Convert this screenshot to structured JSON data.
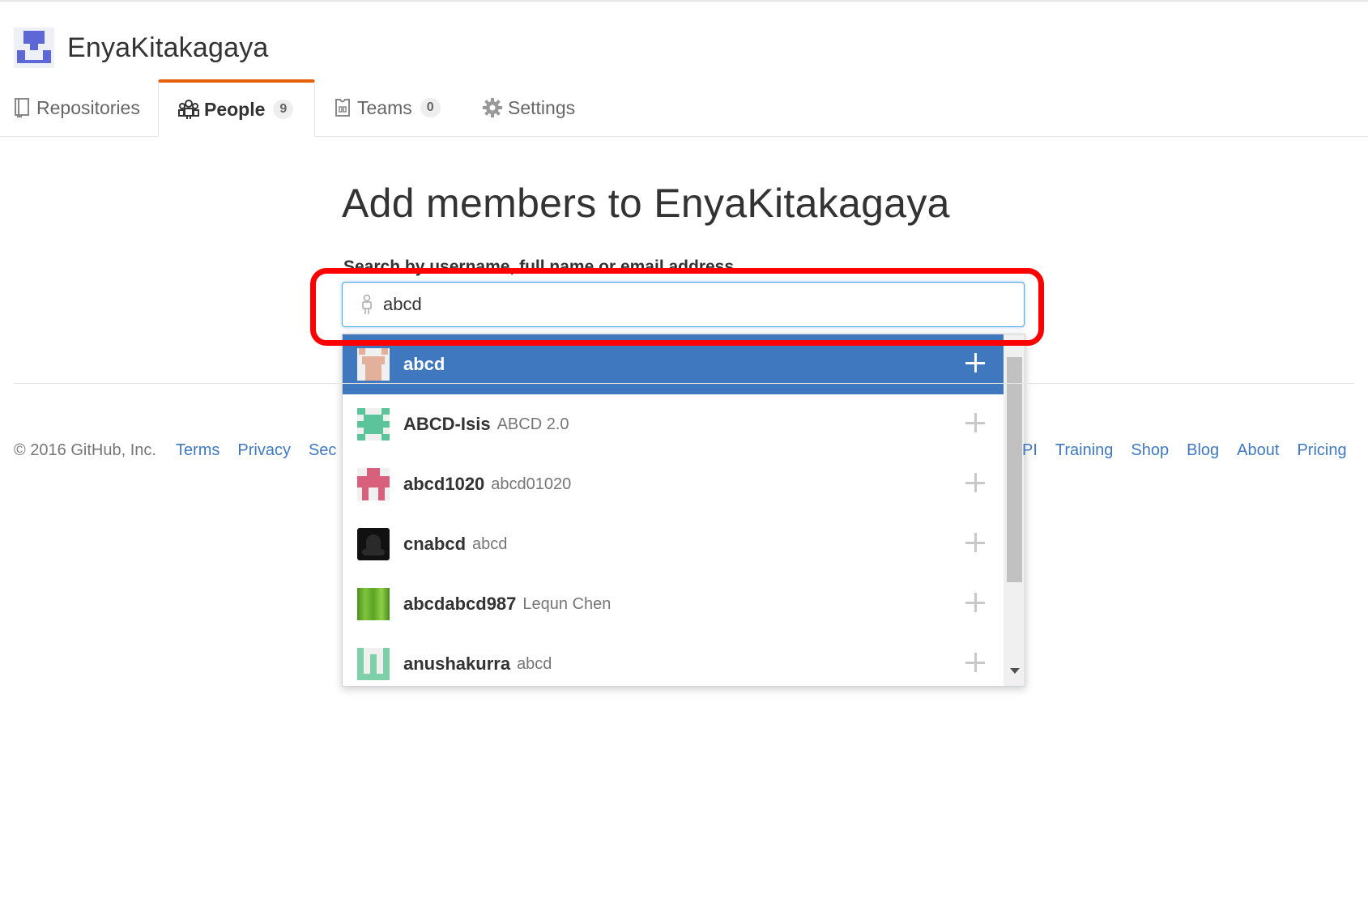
{
  "org": {
    "name": "EnyaKitakagaya"
  },
  "tabs": [
    {
      "label": "Repositories",
      "icon": "repo-icon"
    },
    {
      "label": "People",
      "count": "9",
      "icon": "organization-icon",
      "selected": true
    },
    {
      "label": "Teams",
      "count": "0",
      "icon": "jersey-icon"
    },
    {
      "label": "Settings",
      "icon": "gear-icon"
    }
  ],
  "main": {
    "heading": "Add members to EnyaKitakagaya",
    "search_label": "Search by username, full name or email address",
    "search_value": "abcd"
  },
  "suggestions": [
    {
      "login": "abcd",
      "full_name": "",
      "active": true
    },
    {
      "login": "ABCD-Isis",
      "full_name": "ABCD 2.0"
    },
    {
      "login": "abcd1020",
      "full_name": "abcd01020"
    },
    {
      "login": "cnabcd",
      "full_name": "abcd"
    },
    {
      "login": "abcdabcd987",
      "full_name": "Lequn Chen"
    },
    {
      "login": "anushakurra",
      "full_name": "abcd"
    }
  ],
  "footer": {
    "copyright": "© 2016 GitHub, Inc.",
    "left_links": [
      "Terms",
      "Privacy",
      "Sec"
    ],
    "right_links": [
      "PI",
      "Training",
      "Shop",
      "Blog",
      "About",
      "Pricing"
    ]
  },
  "colors": {
    "accent_tab": "#e36209",
    "active_row": "#4078c0",
    "highlight": "#ff0000",
    "link": "#4078c0"
  }
}
